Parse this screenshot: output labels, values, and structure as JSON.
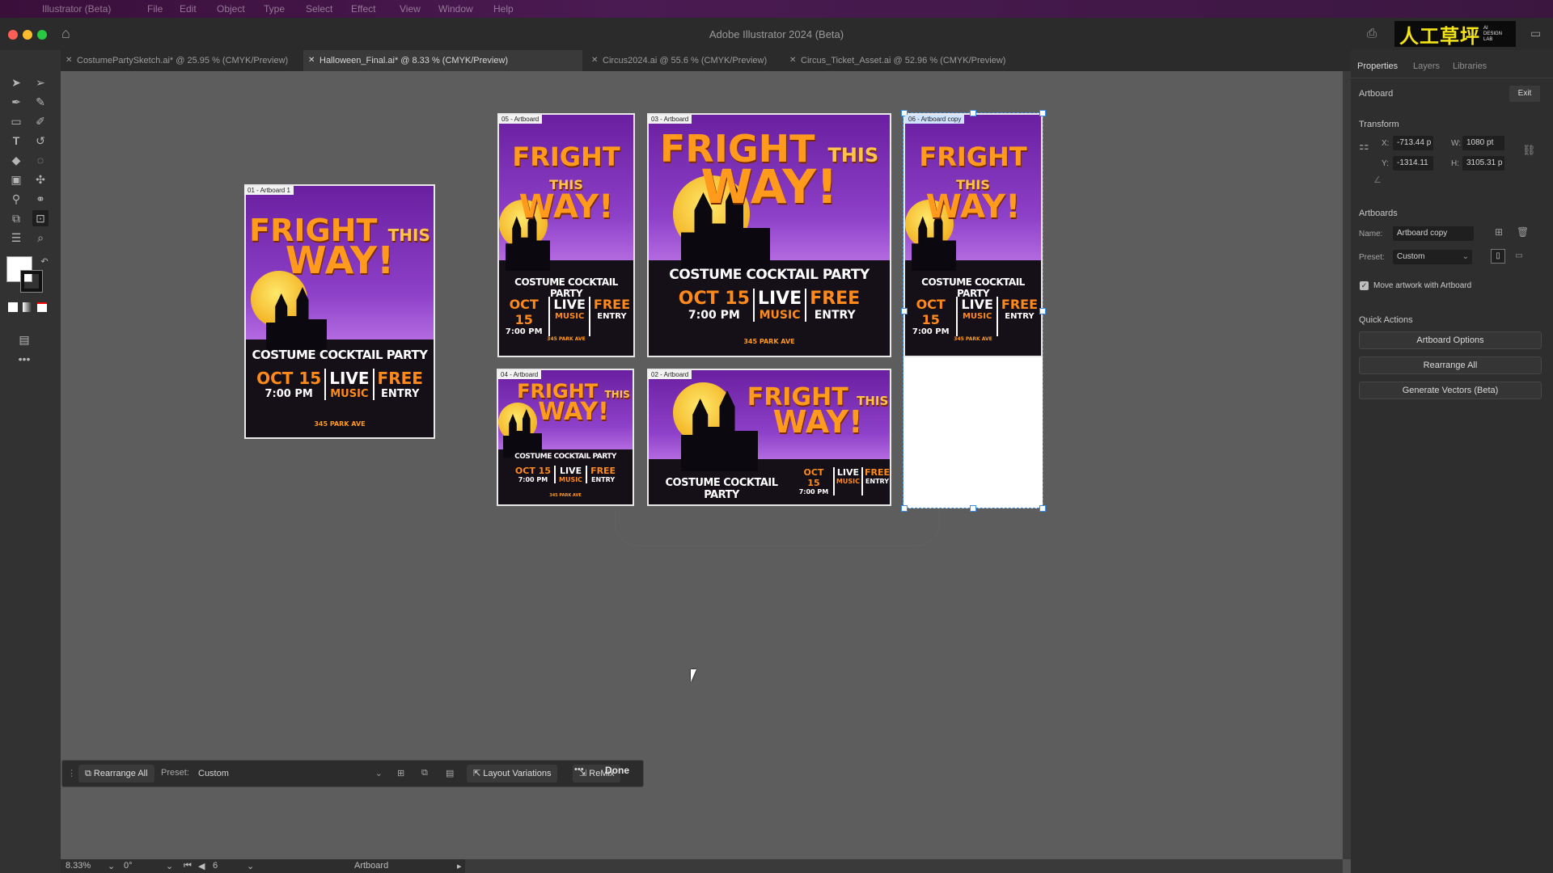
{
  "menubar": {
    "items": [
      "Illustrator (Beta)",
      "File",
      "Edit",
      "Object",
      "Type",
      "Select",
      "Effect",
      "View",
      "Window",
      "Help"
    ]
  },
  "app": {
    "title": "Adobe Illustrator 2024 (Beta)",
    "logo_text": "人工草坪",
    "logo_sub1": "AI",
    "logo_sub2": "DESIGN",
    "logo_sub3": "LAB"
  },
  "tabs": [
    {
      "label": "CostumePartySketch.ai* @ 25.95 % (CMYK/Preview)"
    },
    {
      "label": "Halloween_Final.ai* @ 8.33 % (CMYK/Preview)"
    },
    {
      "label": "Circus2024.ai @ 55.6 % (CMYK/Preview)"
    },
    {
      "label": "Circus_Ticket_Asset.ai @ 52.96 % (CMYK/Preview)"
    }
  ],
  "panel": {
    "tabs": [
      "Properties",
      "Layers",
      "Libraries"
    ],
    "section_artboard": "Artboard",
    "exit_label": "Exit",
    "transform_title": "Transform",
    "x_label": "X:",
    "x_value": "-713.44 p",
    "y_label": "Y:",
    "y_value": "-1314.11",
    "w_label": "W:",
    "w_value": "1080 pt",
    "h_label": "H:",
    "h_value": "3105.31 p",
    "artboards_title": "Artboards",
    "name_label": "Name:",
    "name_value": "Artboard copy",
    "preset_label": "Preset:",
    "preset_value": "Custom",
    "move_artwork_label": "Move artwork with Artboard",
    "quick_actions_title": "Quick Actions",
    "btn_options": "Artboard Options",
    "btn_rearrange": "Rearrange All",
    "btn_generate": "Generate Vectors (Beta)"
  },
  "poster": {
    "title1": "FRIGHT",
    "title_this": "THIS",
    "title2": "WAY!",
    "party": "COSTUME COCKTAIL PARTY",
    "date": "OCT 15",
    "time": "7:00 PM",
    "live": "LIVE",
    "music": "MUSIC",
    "free": "FREE",
    "entry": "ENTRY",
    "address": "345 PARK AVE"
  },
  "artboards": {
    "a1": "01 - Artboard 1",
    "a5": "05 - Artboard",
    "a3": "03 - Artboard",
    "a6": "06 - Artboard copy",
    "a4": "04 - Artboard",
    "a2": "02 - Artboard"
  },
  "ctxbar": {
    "rearrange": "Rearrange All",
    "preset_label": "Preset:",
    "preset_value": "Custom",
    "layout_variations": "Layout Variations",
    "remix": "ReMix",
    "more": "•••",
    "done": "Done"
  },
  "status": {
    "zoom": "8.33%",
    "rotate": "0°",
    "page": "6",
    "mode": "Artboard"
  }
}
